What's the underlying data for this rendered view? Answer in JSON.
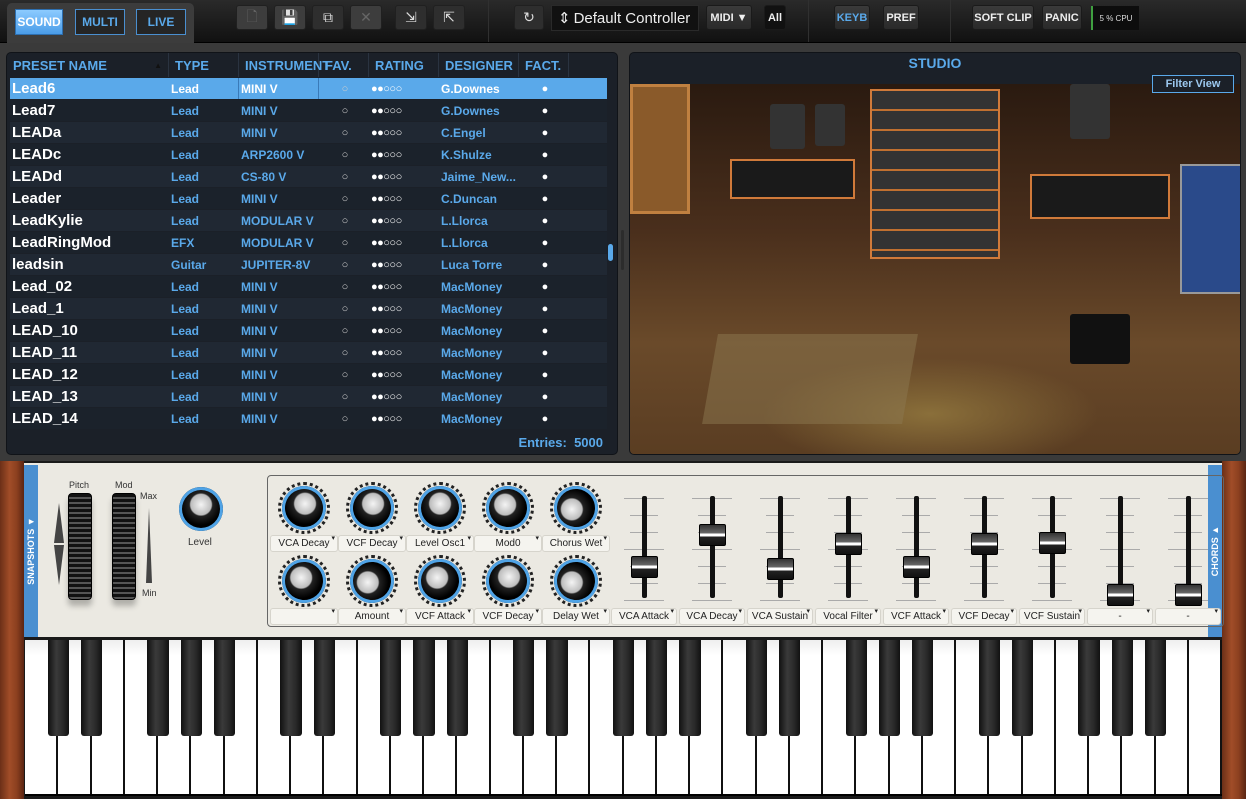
{
  "toolbar": {
    "modes": [
      {
        "label": "SOUND",
        "active": true
      },
      {
        "label": "MULTI",
        "active": false
      },
      {
        "label": "LIVE",
        "active": false
      }
    ],
    "file_icons": [
      "new-preset-icon",
      "save-icon",
      "save-as-icon",
      "delete-icon",
      "import-icon",
      "export-icon"
    ],
    "midi_refresh_icon": "refresh-icon",
    "controller": "Default Controller",
    "midi_label": "MIDI ▼",
    "channel_label": "All",
    "keyb_label": "KEYB",
    "pref_label": "PREF",
    "softclip_label": "SOFT CLIP",
    "panic_label": "PANIC",
    "cpu_label": "5 % CPU"
  },
  "browser": {
    "columns": [
      "PRESET NAME",
      "TYPE",
      "INSTRUMENT",
      "FAV.",
      "RATING",
      "DESIGNER",
      "FACT."
    ],
    "sort_indicator": "▲",
    "rows": [
      {
        "name": "Lead6",
        "type": "Lead",
        "instrument": "MINI V",
        "fav": "○",
        "rating": "●●○○○",
        "designer": "G.Downes",
        "factory": "●",
        "selected": true
      },
      {
        "name": "Lead7",
        "type": "Lead",
        "instrument": "MINI V",
        "fav": "○",
        "rating": "●●○○○",
        "designer": "G.Downes",
        "factory": "●"
      },
      {
        "name": "LEADa",
        "type": "Lead",
        "instrument": "MINI V",
        "fav": "○",
        "rating": "●●○○○",
        "designer": "C.Engel",
        "factory": "●"
      },
      {
        "name": "LEADc",
        "type": "Lead",
        "instrument": "ARP2600 V",
        "fav": "○",
        "rating": "●●○○○",
        "designer": "K.Shulze",
        "factory": "●"
      },
      {
        "name": "LEADd",
        "type": "Lead",
        "instrument": "CS-80 V",
        "fav": "○",
        "rating": "●●○○○",
        "designer": "Jaime_New...",
        "factory": "●"
      },
      {
        "name": "Leader",
        "type": "Lead",
        "instrument": "MINI V",
        "fav": "○",
        "rating": "●●○○○",
        "designer": "C.Duncan",
        "factory": "●"
      },
      {
        "name": "LeadKylie",
        "type": "Lead",
        "instrument": "MODULAR V",
        "fav": "○",
        "rating": "●●○○○",
        "designer": "L.Llorca",
        "factory": "●"
      },
      {
        "name": "LeadRingMod",
        "type": "EFX",
        "instrument": "MODULAR V",
        "fav": "○",
        "rating": "●●○○○",
        "designer": "L.Llorca",
        "factory": "●"
      },
      {
        "name": "leadsin",
        "type": "Guitar",
        "instrument": "JUPITER-8V",
        "fav": "○",
        "rating": "●●○○○",
        "designer": "Luca Torre",
        "factory": "●"
      },
      {
        "name": "Lead_02",
        "type": "Lead",
        "instrument": "MINI V",
        "fav": "○",
        "rating": "●●○○○",
        "designer": "MacMoney",
        "factory": "●"
      },
      {
        "name": "Lead_1",
        "type": "Lead",
        "instrument": "MINI V",
        "fav": "○",
        "rating": "●●○○○",
        "designer": "MacMoney",
        "factory": "●"
      },
      {
        "name": "LEAD_10",
        "type": "Lead",
        "instrument": "MINI V",
        "fav": "○",
        "rating": "●●○○○",
        "designer": "MacMoney",
        "factory": "●"
      },
      {
        "name": "LEAD_11",
        "type": "Lead",
        "instrument": "MINI V",
        "fav": "○",
        "rating": "●●○○○",
        "designer": "MacMoney",
        "factory": "●"
      },
      {
        "name": "LEAD_12",
        "type": "Lead",
        "instrument": "MINI V",
        "fav": "○",
        "rating": "●●○○○",
        "designer": "MacMoney",
        "factory": "●"
      },
      {
        "name": "LEAD_13",
        "type": "Lead",
        "instrument": "MINI V",
        "fav": "○",
        "rating": "●●○○○",
        "designer": "MacMoney",
        "factory": "●"
      },
      {
        "name": "LEAD_14",
        "type": "Lead",
        "instrument": "MINI V",
        "fav": "○",
        "rating": "●●○○○",
        "designer": "MacMoney",
        "factory": "●"
      }
    ],
    "entries_label": "Entries:",
    "entries_count": "5000"
  },
  "studio": {
    "title": "STUDIO",
    "filter_view_label": "Filter View"
  },
  "synth": {
    "snapshots_label": "SNAPSHOTS ▼",
    "chords_label": "CHORDS ▲",
    "pitch_label": "Pitch",
    "mod_label": "Mod",
    "mod_max": "Max",
    "mod_min": "Min",
    "level_label": "Level",
    "knobs_top": [
      {
        "label": "VCA Decay",
        "value": 0.55
      },
      {
        "label": "VCF Decay",
        "value": 0.55
      },
      {
        "label": "Level Osc1",
        "value": 0.5
      },
      {
        "label": "Mod0",
        "value": 0.35
      },
      {
        "label": "Chorus Wet",
        "value": 0.1
      }
    ],
    "knobs_bottom": [
      {
        "label": "",
        "value": 0.35
      },
      {
        "label": "Amount",
        "value": 0.1
      },
      {
        "label": "VCF Attack",
        "value": 0.35
      },
      {
        "label": "VCF Decay",
        "value": 0.55
      },
      {
        "label": "Delay Wet",
        "value": 0.1
      }
    ],
    "faders": [
      {
        "label": "VCA Attack",
        "value": 0.3
      },
      {
        "label": "VCA Decay",
        "value": 0.65
      },
      {
        "label": "VCA Sustain",
        "value": 0.28
      },
      {
        "label": "Vocal Filter",
        "value": 0.55
      },
      {
        "label": "VCF Attack",
        "value": 0.3
      },
      {
        "label": "VCF Decay",
        "value": 0.55
      },
      {
        "label": "VCF Sustain",
        "value": 0.57
      },
      {
        "label": "-",
        "value": 0.0
      },
      {
        "label": "-",
        "value": 0.0
      }
    ]
  },
  "keyboard": {
    "white_keys": 36,
    "first_note": "C"
  }
}
